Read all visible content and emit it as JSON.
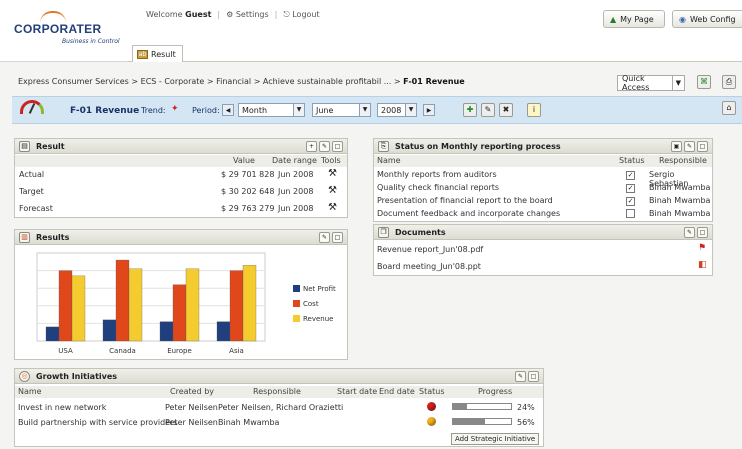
{
  "header": {
    "logo": "CORPORATER",
    "logo_sub": "Business in Control",
    "welcome": "Welcome",
    "user": "Guest",
    "settings": "Settings",
    "logout": "Logout",
    "my_page": "My Page",
    "web_config": "Web Config",
    "tab": "Result"
  },
  "breadcrumb": {
    "path": "Express Consumer Services > ECS - Corporate > Financial > Achieve sustainable profitabil ... >",
    "current": "F-01 Revenue",
    "quick_access": "Quick Access"
  },
  "toolbar": {
    "kpi": "F-01 Revenue",
    "trend_label": "Trend:",
    "period_label": "Period:",
    "period": "Month",
    "month": "June",
    "year": "2008"
  },
  "result": {
    "title": "Result",
    "headers": [
      "Value",
      "Date range",
      "Tools"
    ],
    "rows": [
      {
        "label": "Actual",
        "value": "$ 29 701 828",
        "date": "Jun 2008"
      },
      {
        "label": "Target",
        "value": "$ 30 202 648",
        "date": "Jun 2008"
      },
      {
        "label": "Forecast",
        "value": "$ 29 763 279",
        "date": "Jun 2008"
      }
    ]
  },
  "status": {
    "title": "Status on Monthly reporting process",
    "headers": [
      "Name",
      "Status",
      "Responsible"
    ],
    "rows": [
      {
        "name": "Monthly reports from auditors",
        "checked": true,
        "resp": "Sergio Sebastian"
      },
      {
        "name": "Quality check financial reports",
        "checked": true,
        "resp": "Binah Mwamba"
      },
      {
        "name": "Presentation of financial report to the board",
        "checked": true,
        "resp": "Binah Mwamba"
      },
      {
        "name": "Document feedback and incorporate changes",
        "checked": false,
        "resp": "Binah Mwamba"
      }
    ]
  },
  "documents": {
    "title": "Documents",
    "items": [
      "Revenue report_Jun'08.pdf",
      "Board meeting_Jun'08.ppt"
    ]
  },
  "chart_panel": {
    "title": "Results"
  },
  "chart_data": {
    "type": "bar",
    "categories": [
      "USA",
      "Canada",
      "Europe",
      "Asia"
    ],
    "series": [
      {
        "name": "Net Profit",
        "color": "#1f3f7f",
        "values": [
          8,
          12,
          11,
          11
        ]
      },
      {
        "name": "Cost",
        "color": "#e0481c",
        "values": [
          40,
          46,
          32,
          40
        ]
      },
      {
        "name": "Revenue",
        "color": "#f5cc30",
        "values": [
          37,
          41,
          41,
          43
        ]
      }
    ],
    "legend": "right"
  },
  "growth": {
    "title": "Growth Initiatives",
    "headers": [
      "Name",
      "Created by",
      "Responsible",
      "Start date",
      "End date",
      "Status",
      "Progress"
    ],
    "rows": [
      {
        "name": "Invest in new network",
        "created": "Peter Neilsen",
        "resp": "Peter Neilsen, Richard Orazietti",
        "status_color": "#cc2222",
        "progress": 24,
        "progress_label": "24%"
      },
      {
        "name": "Build partnership with service providers",
        "created": "Peter Neilsen",
        "resp": "Binah Mwamba",
        "status_color": "#f0b020",
        "progress": 56,
        "progress_label": "56%"
      }
    ],
    "add_button": "Add Strategic Initiative"
  }
}
